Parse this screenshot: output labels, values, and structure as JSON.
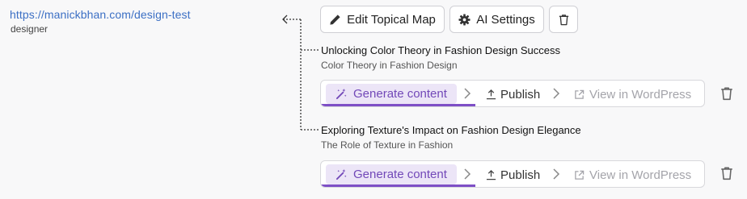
{
  "site": {
    "url": "https://manickbhan.com/design-test",
    "role": "designer"
  },
  "toolbar": {
    "edit_label": "Edit Topical Map",
    "ai_label": "AI Settings"
  },
  "articles": [
    {
      "title": "Unlocking Color Theory in Fashion Design Success",
      "subtitle": "Color Theory in Fashion Design",
      "generate_label": "Generate content",
      "publish_label": "Publish",
      "view_label": "View in WordPress"
    },
    {
      "title": "Exploring Texture's Impact on Fashion Design Elegance",
      "subtitle": "The Role of Texture in Fashion",
      "generate_label": "Generate content",
      "publish_label": "Publish",
      "view_label": "View in WordPress"
    }
  ],
  "colors": {
    "link": "#3b6fc4",
    "accent": "#7e4fc6",
    "accent_bg": "#ece5f7",
    "muted": "#a4a4aa"
  },
  "icons": [
    "pencil-icon",
    "gear-icon",
    "trash-icon",
    "magic-wand-icon",
    "upload-icon",
    "external-link-icon",
    "chevron-right-icon",
    "arrow-left-icon"
  ]
}
